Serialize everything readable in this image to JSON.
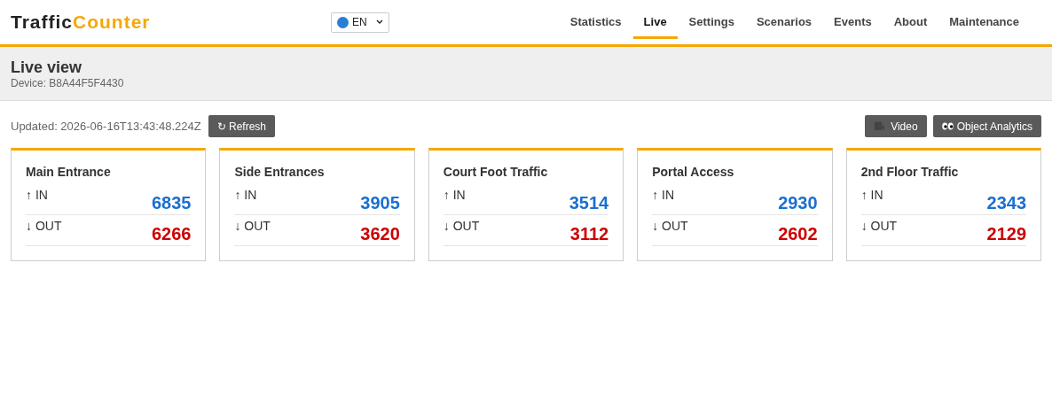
{
  "brand": {
    "part_1": "Traffic",
    "part_2": "Counter"
  },
  "language": {
    "value": "EN"
  },
  "nav": [
    {
      "label": "Statistics",
      "selected": false
    },
    {
      "label": "Live",
      "selected": true
    },
    {
      "label": "Settings",
      "selected": false
    },
    {
      "label": "Scenarios",
      "selected": false
    },
    {
      "label": "Events",
      "selected": false
    },
    {
      "label": "About",
      "selected": false
    },
    {
      "label": "Maintenance",
      "selected": false
    }
  ],
  "page": {
    "title": "Live view",
    "device": "Device: B8A44F5F4430"
  },
  "toolbar": {
    "updated": "Updated: 2026-06-16T13:43:48.224Z",
    "refresh_button": "↻ Refresh",
    "video_button": "Video",
    "analytics_button": "Object Analytics"
  },
  "counters": [
    {
      "name": "Main Entrance",
      "in_label": "↑ IN",
      "in": "6835",
      "out_label": "↓ OUT",
      "out": "6266"
    },
    {
      "name": "Side Entrances",
      "in_label": "↑ IN",
      "in": "3905",
      "out_label": "↓ OUT",
      "out": "3620"
    },
    {
      "name": "Court Foot Traffic",
      "in_label": "↑ IN",
      "in": "3514",
      "out_label": "↓ OUT",
      "out": "3112"
    },
    {
      "name": "Portal Access",
      "in_label": "↑ IN",
      "in": "2930",
      "out_label": "↓ OUT",
      "out": "2602"
    },
    {
      "name": "2nd Floor Traffic",
      "in_label": "↑ IN",
      "in": "2343",
      "out_label": "↓ OUT",
      "out": "2129"
    }
  ]
}
